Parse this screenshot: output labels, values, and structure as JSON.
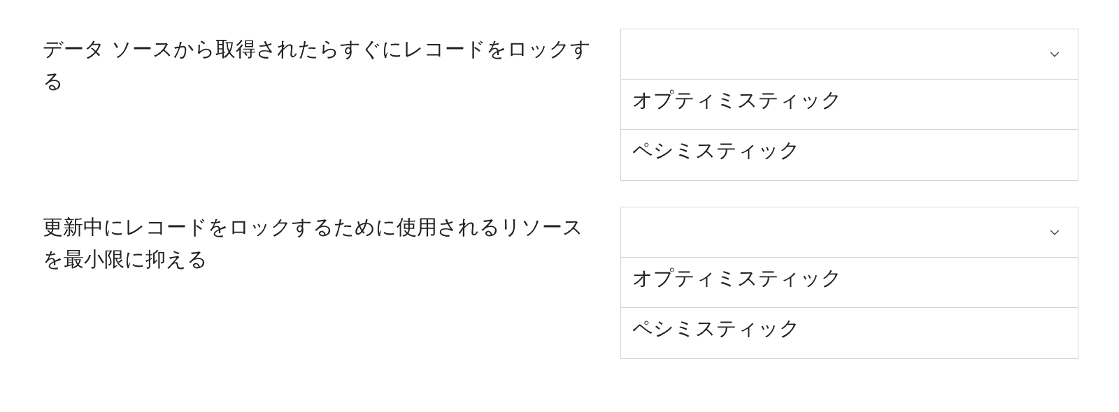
{
  "questions": [
    {
      "text": "データ ソースから取得されたらすぐにレコードをロックする",
      "dropdown": {
        "options": [
          {
            "label": "オプティミスティック"
          },
          {
            "label": "ペシミスティック"
          }
        ]
      }
    },
    {
      "text": "更新中にレコードをロックするために使用されるリソースを最小限に抑える",
      "dropdown": {
        "options": [
          {
            "label": "オプティミスティック"
          },
          {
            "label": "ペシミスティック"
          }
        ]
      }
    }
  ]
}
